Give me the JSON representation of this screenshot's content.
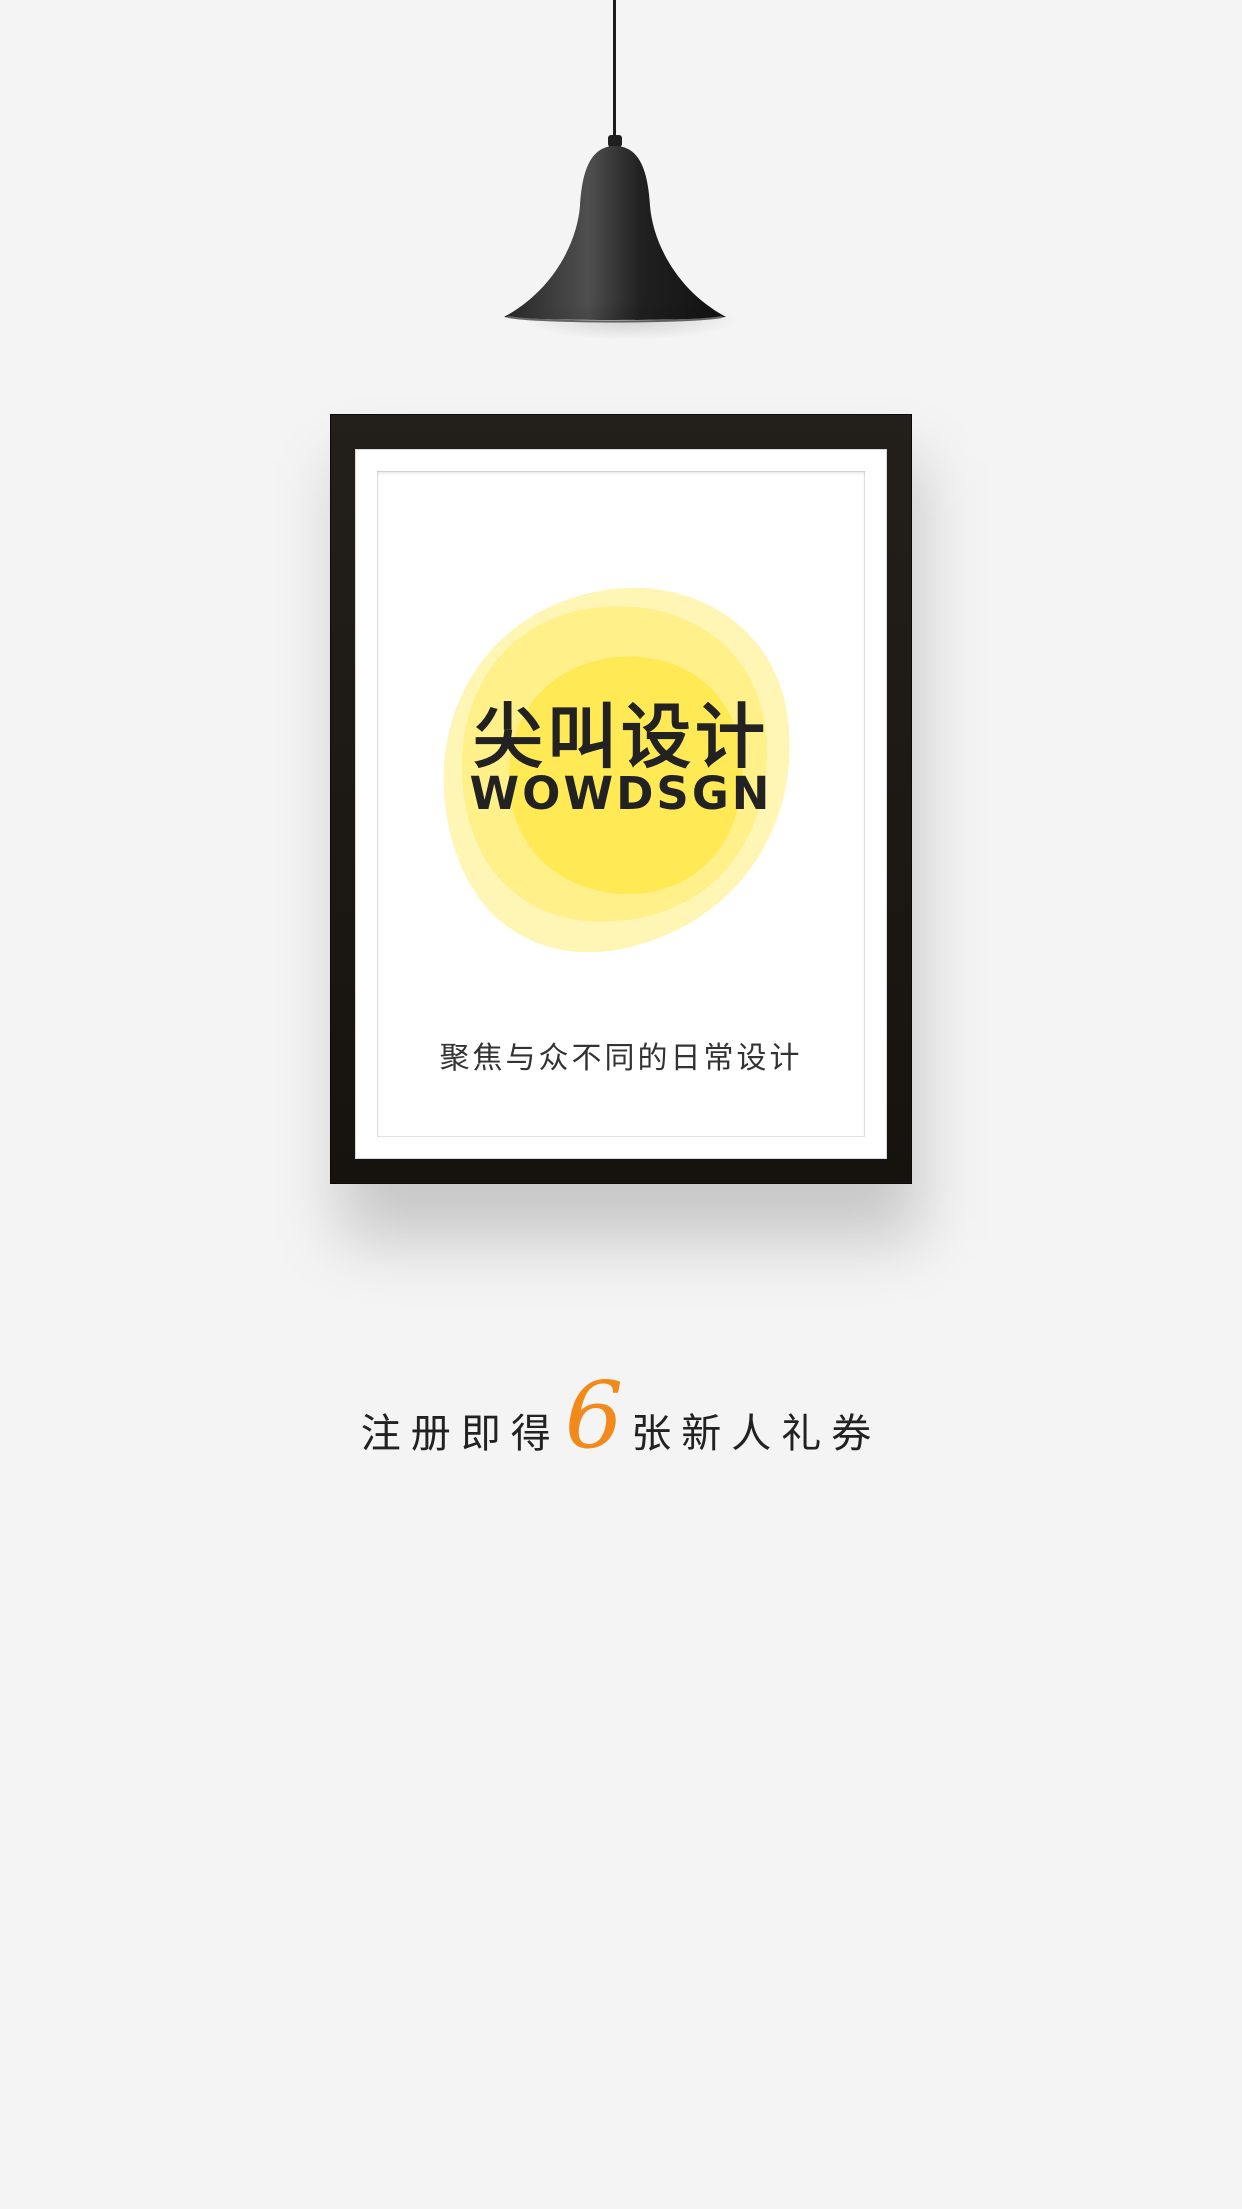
{
  "lamp": {
    "icon": "pendant-lamp-icon"
  },
  "poster": {
    "brand_cn": "尖叫设计",
    "brand_en": "WOWDSGN",
    "slogan": "聚焦与众不同的日常设计",
    "accent_color": "#ffe74a"
  },
  "promo": {
    "prefix": "注册即得",
    "number": "6",
    "suffix": "张新人礼券",
    "number_color": "#f28a1b"
  }
}
